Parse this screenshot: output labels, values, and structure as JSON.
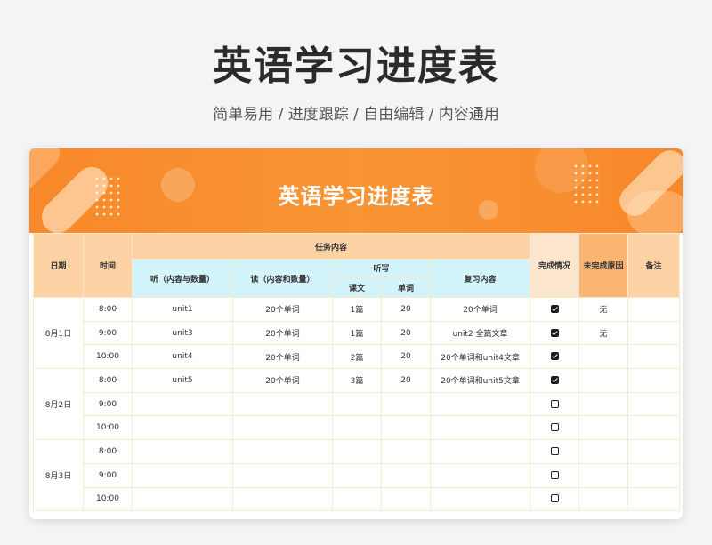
{
  "page": {
    "title": "英语学习进度表",
    "subtitle": "简单易用 / 进度跟踪 / 自由编辑 / 内容通用"
  },
  "sheet": {
    "banner_title": "英语学习进度表",
    "headers": {
      "date": "日期",
      "time": "时间",
      "task_content": "任务内容",
      "listen": "听（内容与数量）",
      "read": "读（内容和数量）",
      "dictation": "听写",
      "lesson": "课文",
      "words": "单词",
      "review": "复习内容",
      "completion": "完成情况",
      "reason": "未完成原因",
      "remarks": "备注"
    },
    "groups": [
      {
        "date": "8月1日",
        "rows": [
          {
            "time": "8:00",
            "listen": "unit1",
            "read": "20个单词",
            "lesson": "1篇",
            "words": "20",
            "review": "20个单词",
            "done": true,
            "reason": "无",
            "remark": ""
          },
          {
            "time": "9:00",
            "listen": "unit3",
            "read": "20个单词",
            "lesson": "1篇",
            "words": "20",
            "review": "unit2 全篇文章",
            "done": true,
            "reason": "无",
            "remark": ""
          },
          {
            "time": "10:00",
            "listen": "unit4",
            "read": "20个单词",
            "lesson": "2篇",
            "words": "20",
            "review": "20个单词和unit4文章",
            "done": true,
            "reason": "",
            "remark": ""
          }
        ]
      },
      {
        "date": "8月2日",
        "rows": [
          {
            "time": "8:00",
            "listen": "unit5",
            "read": "20个单词",
            "lesson": "3篇",
            "words": "20",
            "review": "20个单词和unit5文章",
            "done": true,
            "reason": "",
            "remark": ""
          },
          {
            "time": "9:00",
            "listen": "",
            "read": "",
            "lesson": "",
            "words": "",
            "review": "",
            "done": false,
            "reason": "",
            "remark": ""
          },
          {
            "time": "10:00",
            "listen": "",
            "read": "",
            "lesson": "",
            "words": "",
            "review": "",
            "done": false,
            "reason": "",
            "remark": ""
          }
        ]
      },
      {
        "date": "8月3日",
        "rows": [
          {
            "time": "8:00",
            "listen": "",
            "read": "",
            "lesson": "",
            "words": "",
            "review": "",
            "done": false,
            "reason": "",
            "remark": ""
          },
          {
            "time": "9:00",
            "listen": "",
            "read": "",
            "lesson": "",
            "words": "",
            "review": "",
            "done": false,
            "reason": "",
            "remark": ""
          },
          {
            "time": "10:00",
            "listen": "",
            "read": "",
            "lesson": "",
            "words": "",
            "review": "",
            "done": false,
            "reason": "",
            "remark": ""
          }
        ]
      }
    ]
  },
  "colors": {
    "banner": "#f8882a",
    "header_peach": "#fdd3a6",
    "header_cyan": "#d4f4fb",
    "header_orange": "#fbb572",
    "grid": "#fde9d2"
  },
  "icons": {
    "checked": "checkbox-checked-icon",
    "unchecked": "checkbox-unchecked-icon"
  }
}
